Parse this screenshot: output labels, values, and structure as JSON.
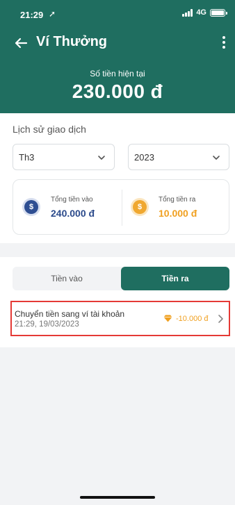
{
  "status_bar": {
    "time": "21:29",
    "location_glyph": "➚",
    "network": "4G"
  },
  "nav": {
    "title": "Ví Thưởng",
    "back_icon": "arrow-left-icon",
    "more_icon": "more-vertical-icon"
  },
  "balance": {
    "label": "Số tiền hiện tại",
    "value": "230.000 đ"
  },
  "history": {
    "title": "Lịch sử giao dịch",
    "month_select": "Th3",
    "year_select": "2023",
    "summary": {
      "in_label": "Tổng tiền vào",
      "in_value": "240.000 đ",
      "in_icon_glyph": "$",
      "out_label": "Tổng tiền ra",
      "out_value": "10.000 đ",
      "out_icon_glyph": "$"
    }
  },
  "tabs": [
    {
      "label": "Tiền vào",
      "active": false
    },
    {
      "label": "Tiền ra",
      "active": true
    }
  ],
  "transactions": [
    {
      "title": "Chuyển tiền sang ví tài khoản",
      "time": "21:29, 19/03/2023",
      "amount": "-10.000 đ",
      "icon": "diamond-icon"
    }
  ],
  "colors": {
    "primary": "#1f6e60",
    "accent_orange": "#f0a020",
    "accent_blue": "#2b4a8b",
    "highlight_border": "#e53935"
  }
}
